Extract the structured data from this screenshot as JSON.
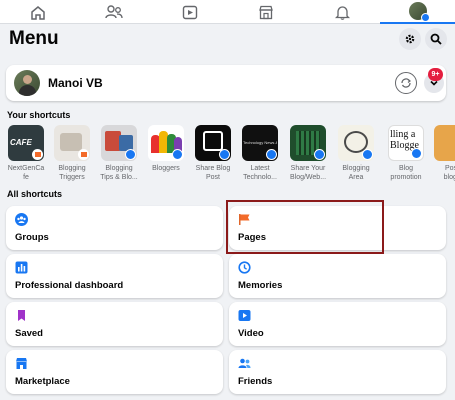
{
  "colors": {
    "accent": "#1877f2",
    "highlight": "#8b1a1a",
    "badge_red": "#e41e3f"
  },
  "nav": {
    "items": [
      {
        "icon": "home-icon"
      },
      {
        "icon": "friends-icon"
      },
      {
        "icon": "video-icon"
      },
      {
        "icon": "marketplace-icon"
      },
      {
        "icon": "bell-icon"
      },
      {
        "icon": "profile-menu-icon",
        "active": true
      }
    ]
  },
  "header": {
    "title": "Menu",
    "settings_icon": "gear-icon",
    "search_icon": "search-icon"
  },
  "profile": {
    "name": "Manoi VB",
    "notification_count": "9+"
  },
  "shortcuts": {
    "label": "Your shortcuts",
    "items": [
      {
        "label": "NextGenCa\nfe"
      },
      {
        "label": "Blogging\nTriggers"
      },
      {
        "label": "Blogging\nTips & Blo..."
      },
      {
        "label": "Bloggers"
      },
      {
        "label": "Share Blog\nPost"
      },
      {
        "label": "Latest\nTechnolo..."
      },
      {
        "label": "Share Your\nBlog/Web..."
      },
      {
        "label": "Blogging\nArea"
      },
      {
        "label": "Blog\npromotion"
      },
      {
        "label": "Post\nblogs"
      }
    ],
    "thumb_texts": {
      "cafe": "CAFE",
      "tech": "Technology News &",
      "bloggers_words": "lling a\nBlogge"
    }
  },
  "all_shortcuts": {
    "label": "All shortcuts",
    "tiles": [
      {
        "label": "Groups",
        "icon": "groups-icon"
      },
      {
        "label": "Pages",
        "icon": "flag-icon"
      },
      {
        "label": "Professional dashboard",
        "icon": "dashboard-icon"
      },
      {
        "label": "Memories",
        "icon": "clock-icon"
      },
      {
        "label": "Saved",
        "icon": "bookmark-icon"
      },
      {
        "label": "Video",
        "icon": "video-icon"
      },
      {
        "label": "Marketplace",
        "icon": "marketplace-icon"
      },
      {
        "label": "Friends",
        "icon": "friends-icon"
      }
    ]
  }
}
